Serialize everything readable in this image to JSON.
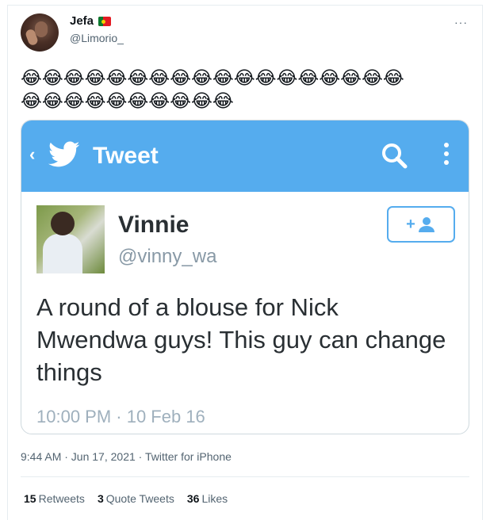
{
  "tweet": {
    "display_name": "Jefa",
    "flag_icon": "portugal-flag-icon",
    "handle": "@Limorio_",
    "more_label": "···",
    "emoji_line_1": "😂😂😂😂😂😂😂😂😂😂😂😂😂😂😂😂😂😂",
    "emoji_line_2": "😂😂😂😂😂😂😂😂😂😂",
    "meta": "9:44 AM · Jun 17, 2021 · Twitter for iPhone",
    "stats": {
      "retweets_count": "15",
      "retweets_label": "Retweets",
      "quotes_count": "3",
      "quotes_label": "Quote Tweets",
      "likes_count": "36",
      "likes_label": "Likes"
    }
  },
  "screenshot": {
    "bar_title": "Tweet",
    "bar_color": "#55acee",
    "back_icon": "chevron-left-icon",
    "search_icon": "search-icon",
    "menu_icon": "kebab-menu-icon",
    "name": "Vinnie",
    "handle": "@vinny_wa",
    "follow_label": "+",
    "text": "A round of a blouse for Nick Mwendwa guys! This guy can change things",
    "timestamp": "10:00 PM · 10 Feb 16"
  }
}
